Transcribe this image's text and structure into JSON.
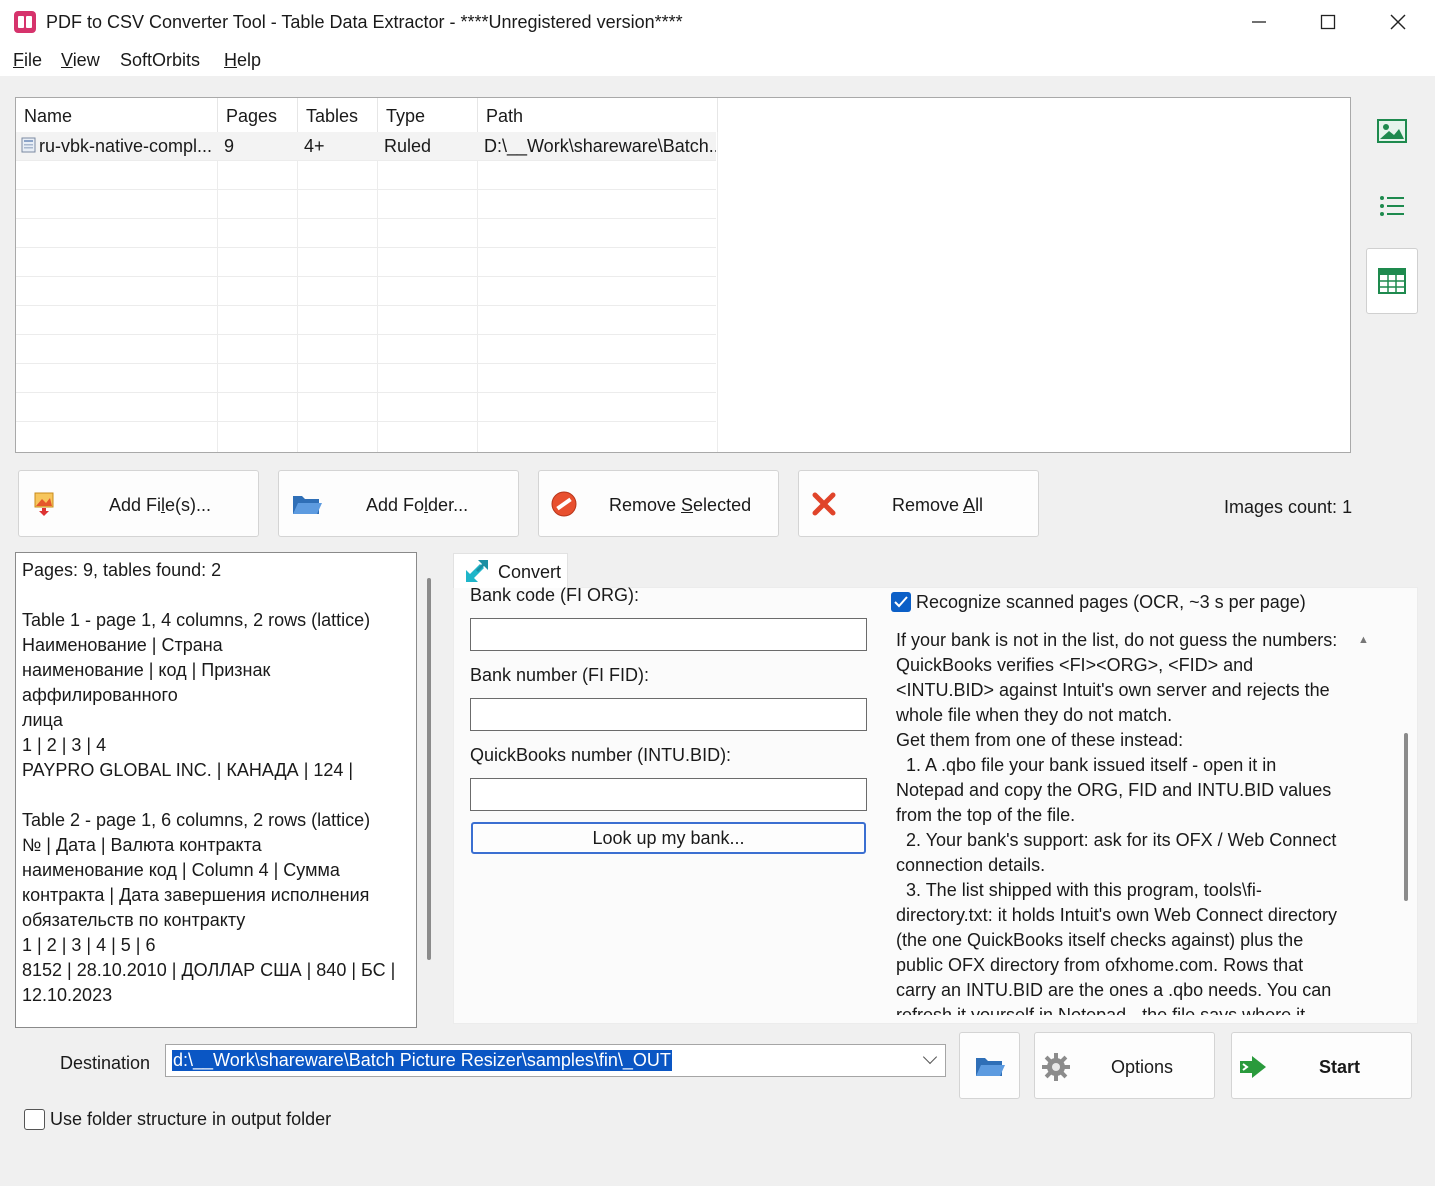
{
  "window": {
    "title": "PDF to CSV Converter Tool - Table Data Extractor - ****Unregistered version****",
    "minimize": "—",
    "maximize": "☐",
    "close": "✕"
  },
  "menu": {
    "file": {
      "ul": "F",
      "rest": "ile"
    },
    "view": {
      "ul": "V",
      "rest": "iew"
    },
    "softorbits": {
      "label": "SoftOrbits"
    },
    "help": {
      "ul": "H",
      "rest": "elp"
    }
  },
  "file_list": {
    "columns": [
      "Name",
      "Pages",
      "Tables",
      "Type",
      "Path"
    ],
    "rows": [
      {
        "name": "ru-vbk-native-compl...",
        "pages": "9",
        "tables": "4+",
        "type": "Ruled",
        "path": "D:\\__Work\\shareware\\Batch..."
      }
    ]
  },
  "side_views": {
    "thumbnails_icon": "image-icon",
    "list_icon": "list-icon",
    "table_icon": "table-icon"
  },
  "actions": {
    "add_files": {
      "pre": "Add Fi",
      "ul": "l",
      "post": "e(s)..."
    },
    "add_folder": {
      "pre": "Add Fo",
      "ul": "l",
      "post": "der..."
    },
    "remove_selected": {
      "pre": "Remove ",
      "ul": "S",
      "post": "elected"
    },
    "remove_all": {
      "pre": "Remove ",
      "ul": "A",
      "post": "ll"
    }
  },
  "images_count": "Images count: 1",
  "log": [
    "Pages: 9, tables found: 2",
    "",
    "Table 1 - page 1, 4 columns, 2 rows (lattice)",
    "Наименование | Страна",
    "наименование | код | Признак",
    "аффилированного",
    "лица",
    "1 | 2 | 3 | 4",
    "PAYPRO GLOBAL INC. | КАНАДА | 124 |",
    "",
    "Table 2 - page 1, 6 columns, 2 rows (lattice)",
    "№ | Дата | Валюта контракта",
    "наименование код | Column 4 | Сумма",
    "контракта | Дата завершения исполнения",
    "обязательств по контракту",
    "1 | 2 | 3 | 4 | 5 | 6",
    "8152 | 28.10.2010 | ДОЛЛАР США | 840 | БС |",
    "12.10.2023"
  ],
  "convert": {
    "tab_label": "Convert",
    "bank_code_label": "Bank code (FI ORG):",
    "bank_code_value": "",
    "bank_number_label": "Bank number (FI FID):",
    "bank_number_value": "",
    "qb_number_label": "QuickBooks number (INTU.BID):",
    "qb_number_value": "",
    "lookup_button": "Look up my bank...",
    "ocr_checked": true,
    "ocr_label": "Recognize scanned pages (OCR, ~3 s per page)",
    "help_lines": [
      "If your bank is not in the list, do not guess the numbers:",
      "QuickBooks verifies <FI><ORG>, <FID> and",
      "<INTU.BID> against Intuit's own server and rejects the",
      "whole file when they do not match.",
      "Get them from one of these instead:",
      "  1. A .qbo file your bank issued itself - open it in",
      "Notepad and copy the ORG, FID and INTU.BID values",
      "from the top of the file.",
      "  2. Your bank's support: ask for its OFX / Web Connect",
      "connection details.",
      "  3. The list shipped with this program, tools\\fi-",
      "directory.txt: it holds Intuit's own Web Connect directory",
      "(the one QuickBooks itself checks against) plus the",
      "public OFX directory from ofxhome.com. Rows that",
      "carry an INTU.BID are the ones a .qbo needs. You can",
      "refresh it yourself in Notepad - the file says where it"
    ]
  },
  "destination": {
    "label": "Destination",
    "value": "d:\\__Work\\shareware\\Batch Picture Resizer\\samples\\fin\\_OUT"
  },
  "options_label": "Options",
  "start_label": "Start",
  "use_folder_structure": {
    "checked": false,
    "label": "Use folder structure in output folder"
  }
}
